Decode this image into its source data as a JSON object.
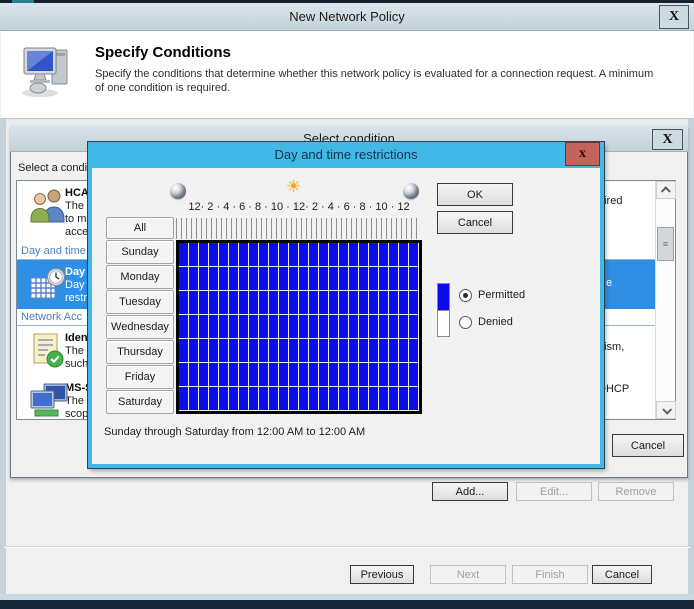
{
  "window": {
    "title": "New Network Policy",
    "close_label": "X"
  },
  "header": {
    "title": "Specify Conditions",
    "description_line1": "Specify the conditions that determine whether this network policy is evaluated for a connection request. A minimum",
    "description_line2": "of one condition is required."
  },
  "select_condition_dialog": {
    "title": "Select condition",
    "close_label": "X",
    "intro_label": "Select a condit",
    "cancel_label": "Cancel",
    "thumb_grip": "≡",
    "list": [
      {
        "type": "item",
        "icon": "users-icon",
        "title": "HCAP",
        "lines": [
          "The H",
          "to mat",
          "acces"
        ]
      },
      {
        "type": "category",
        "label": "Day and time"
      },
      {
        "type": "item",
        "icon": "calendar-clock-icon",
        "title": "Day a",
        "lines": [
          "Day a",
          "restric"
        ],
        "selected": true
      },
      {
        "type": "category",
        "label": "Network Acc"
      },
      {
        "type": "item",
        "icon": "certificate-icon",
        "title": "Ident",
        "lines": [
          "The Id",
          "such a"
        ]
      },
      {
        "type": "item",
        "icon": "computers-icon",
        "title": "MS-S",
        "lines": [
          "The M",
          "scope"
        ]
      }
    ],
    "clipped_fragments": [
      "uired",
      "e",
      "nism,",
      "DHCP"
    ]
  },
  "daytime_dialog": {
    "title": "Day and time restrictions",
    "close_label": "x",
    "ok_label": "OK",
    "cancel_label": "Cancel",
    "sun_glyph": "☀",
    "hour_scale": "12·  2  ·  4  ·  6  ·  8  · 10 · 12·  2  ·  4  ·  6  ·  8  · 10 · 12",
    "day_buttons": [
      "All",
      "Sunday",
      "Monday",
      "Tuesday",
      "Wednesday",
      "Thursday",
      "Friday",
      "Saturday"
    ],
    "legend": {
      "permitted_label": "Permitted",
      "denied_label": "Denied",
      "selected": "Permitted",
      "permitted_color": "#0b0bee",
      "denied_color": "#ffffff"
    },
    "schedule": {
      "days": [
        "Sunday",
        "Monday",
        "Tuesday",
        "Wednesday",
        "Thursday",
        "Friday",
        "Saturday"
      ],
      "hours_per_day": 24,
      "all_cells": "permitted"
    },
    "status_text": "Sunday through Saturday from 12:00 AM to 12:00 AM"
  },
  "wizard_buttons": {
    "add_label": "Add...",
    "edit_label": "Edit...",
    "remove_label": "Remove",
    "previous_label": "Previous",
    "next_label": "Next",
    "finish_label": "Finish",
    "cancel_label": "Cancel"
  },
  "colors": {
    "modal_accent": "#41b9e6",
    "selection_blue": "#2e8fe5",
    "grid_permitted": "#0b0bee",
    "titlebar": "#c9d7e0",
    "close_button_red": "#c4635c"
  }
}
